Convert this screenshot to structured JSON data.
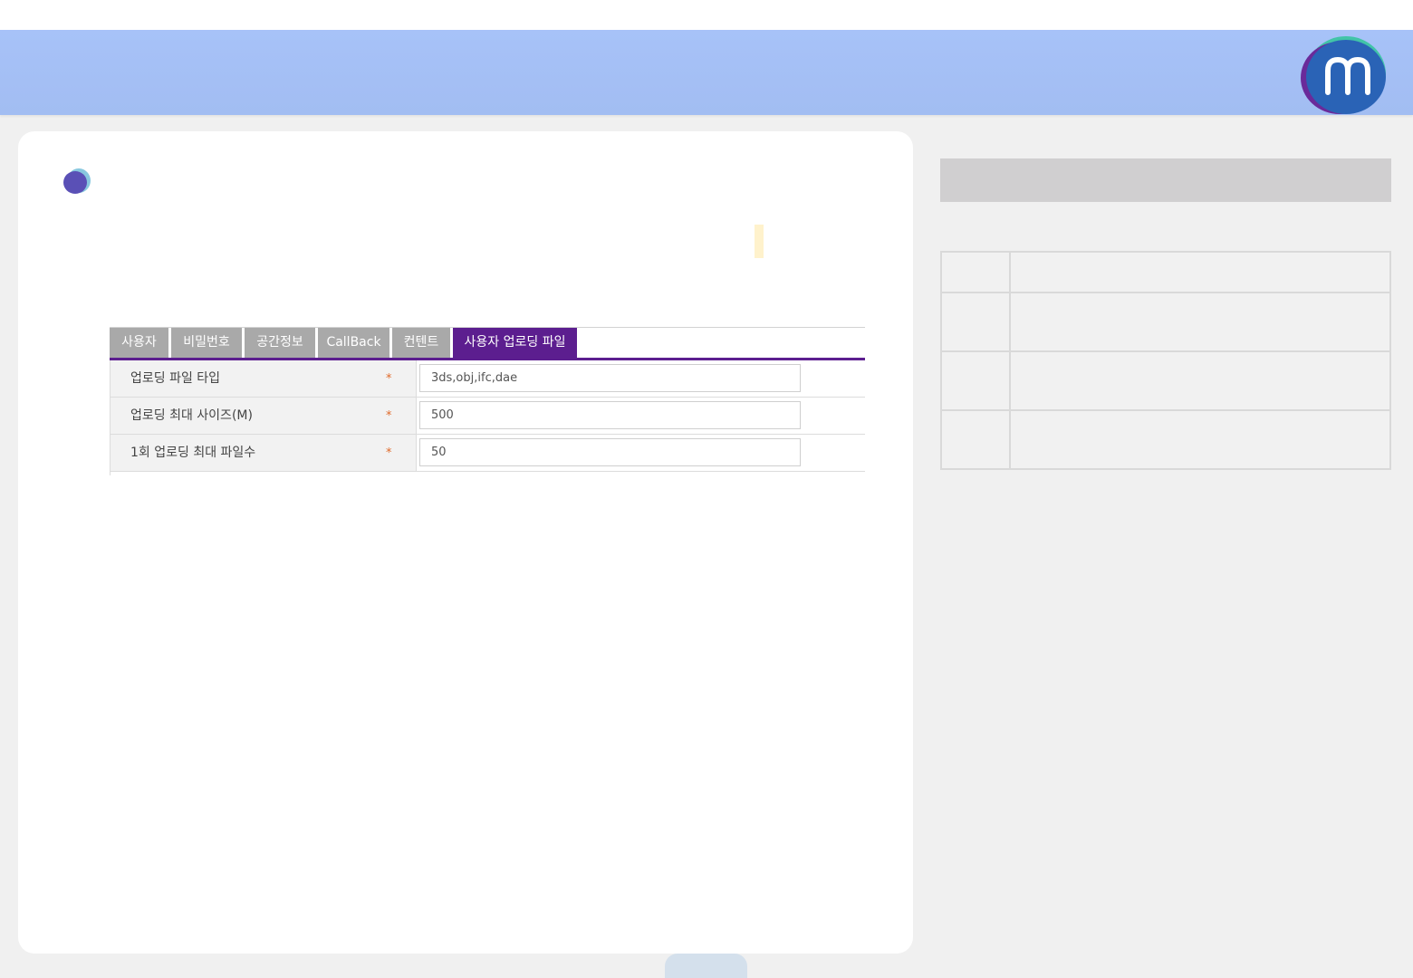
{
  "app": {
    "brand_color": "#5c1e8f",
    "header_color": "#a7c2f8",
    "logo_icon": "m-logo-icon"
  },
  "tabs": [
    {
      "label": "사용자",
      "active": false
    },
    {
      "label": "비밀번호",
      "active": false
    },
    {
      "label": "공간정보",
      "active": false
    },
    {
      "label": "CallBack",
      "active": false
    },
    {
      "label": "컨텐트",
      "active": false
    },
    {
      "label": "사용자 업로딩 파일",
      "active": true
    }
  ],
  "form": {
    "required_mark": "*",
    "rows": [
      {
        "label": "업로딩 파일 타입",
        "value": "3ds,obj,ifc,dae"
      },
      {
        "label": "업로딩 최대 사이즈(M)",
        "value": "500"
      },
      {
        "label": "1회 업로딩 최대 파일수",
        "value": "50"
      }
    ]
  }
}
